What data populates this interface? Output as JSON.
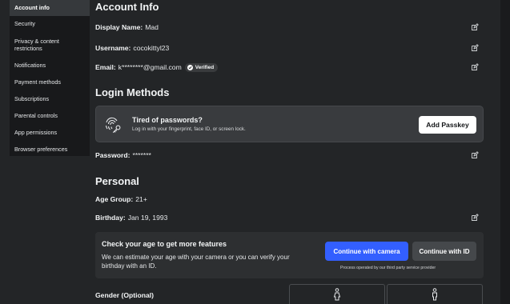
{
  "sidebar": {
    "items": [
      {
        "label": "Account info",
        "active": true
      },
      {
        "label": "Security"
      },
      {
        "label": "Privacy & content restrictions"
      },
      {
        "label": "Notifications"
      },
      {
        "label": "Payment methods"
      },
      {
        "label": "Subscriptions"
      },
      {
        "label": "Parental controls"
      },
      {
        "label": "App permissions"
      },
      {
        "label": "Browser preferences"
      }
    ]
  },
  "account": {
    "title": "Account Info",
    "display_name_label": "Display Name:",
    "display_name": "Mad",
    "username_label": "Username:",
    "username": "cocokittyl23",
    "email_label": "Email:",
    "email": "k********@gmail.com",
    "verified": "Verified"
  },
  "login": {
    "title": "Login Methods",
    "passkey_title": "Tired of passwords?",
    "passkey_sub": "Log in with your fingerprint, face ID, or screen lock.",
    "add_passkey": "Add Passkey",
    "password_label": "Password:",
    "password": "*******"
  },
  "personal": {
    "title": "Personal",
    "age_group_label": "Age Group:",
    "age_group": "21+",
    "birthday_label": "Birthday:",
    "birthday": "Jan 19, 1993",
    "age_card_title": "Check your age to get more features",
    "age_card_text": "We can estimate your age with your camera or you can verify your birthday with an ID.",
    "camera_button": "Continue with camera",
    "id_button": "Continue with ID",
    "provider_note": "Process operated by our third party service provider",
    "gender_label": "Gender (Optional)"
  },
  "colors": {
    "background": "#232527",
    "sidebar": "#18191b",
    "accent_blue": "#335fff",
    "card": "#393b3e"
  }
}
